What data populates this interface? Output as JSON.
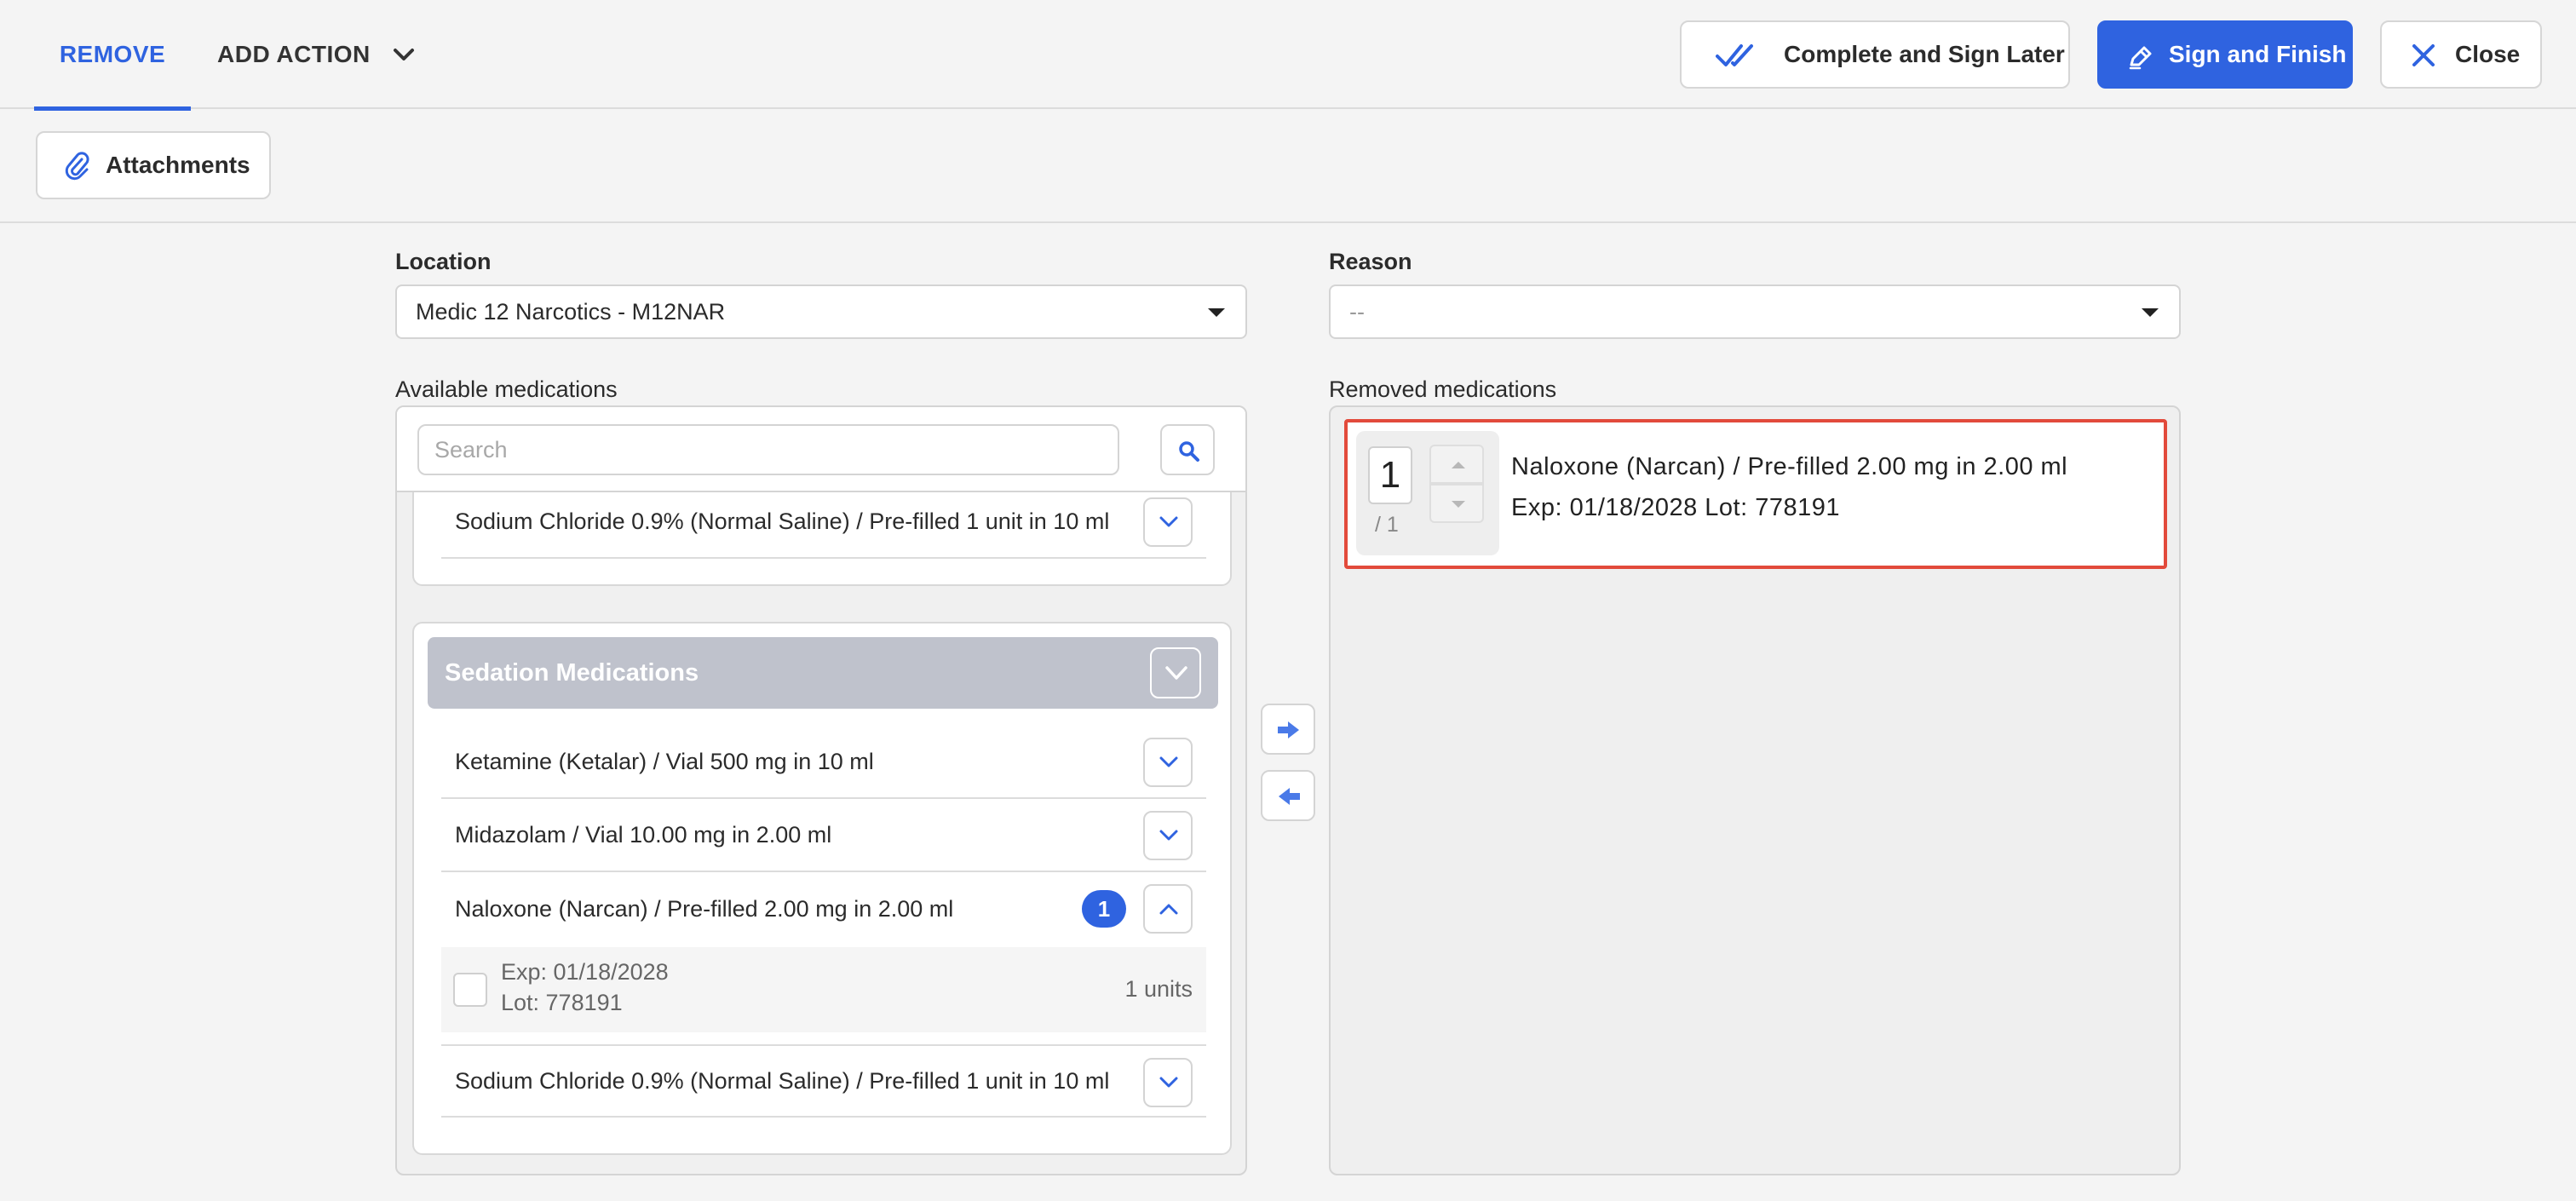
{
  "tabs": {
    "remove_label": "REMOVE",
    "add_action_label": "ADD ACTION"
  },
  "actions": {
    "complete_later_label": "Complete and Sign Later",
    "sign_finish_label": "Sign and Finish",
    "close_label": "Close"
  },
  "attachments_label": "Attachments",
  "location": {
    "label": "Location",
    "value": "Medic 12 Narcotics - M12NAR"
  },
  "reason": {
    "label": "Reason",
    "value": "--"
  },
  "available": {
    "label": "Available medications",
    "search_placeholder": "Search",
    "top_card": {
      "items": [
        {
          "name": "Sodium Chloride 0.9% (Normal Saline) / Pre-filled 1 unit in 10 ml"
        }
      ]
    },
    "group": {
      "title": "Sedation Medications",
      "items": [
        {
          "name": "Ketamine (Ketalar) / Vial 500 mg in 10 ml"
        },
        {
          "name": "Midazolam / Vial 10.00 mg in 2.00 ml"
        },
        {
          "name": "Naloxone (Narcan) / Pre-filled 2.00 mg in 2.00 ml",
          "badge": "1"
        },
        {
          "name": "Sodium Chloride 0.9% (Normal Saline) / Pre-filled 1 unit in 10 ml"
        }
      ],
      "lot": {
        "exp": "Exp: 01/18/2028",
        "lot": "Lot: 778191",
        "units": "1 units"
      }
    }
  },
  "removed": {
    "label": "Removed medications",
    "item": {
      "qty": "1",
      "qty_of": "/ 1",
      "name": "Naloxone (Narcan) / Pre-filled 2.00 mg in 2.00 ml",
      "meta": "Exp: 01/18/2028 Lot: 778191"
    }
  },
  "colors": {
    "accent": "#2f63e0",
    "highlight_border": "#e24a3b",
    "group_header": "#bfc2cc"
  }
}
